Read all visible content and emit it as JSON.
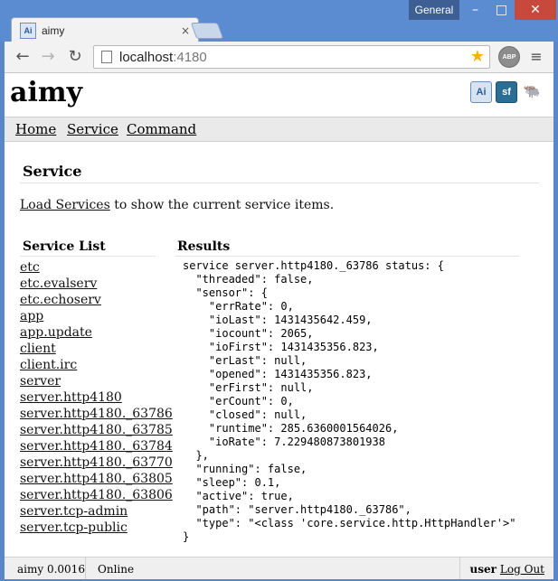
{
  "window": {
    "profile": "General",
    "min": "–",
    "max": "□",
    "close": "✕"
  },
  "tab": {
    "title": "aimy",
    "favicon_text": "Ai",
    "close": "×"
  },
  "toolbar": {
    "back": "←",
    "forward": "→",
    "reload": "↻",
    "url_host": "localhost",
    "url_port": ":4180",
    "star": "★",
    "abp": "ABP",
    "menu": "≡"
  },
  "page": {
    "site_title": "aimy",
    "header_icons": [
      "Ai",
      "sf",
      "🐃"
    ],
    "nav": [
      "Home",
      "Service",
      "Command"
    ],
    "section_title": "Service",
    "intro_link": "Load Services",
    "intro_text": " to show the current service items.",
    "list_title": "Service List",
    "services": [
      "etc",
      "etc.evalserv",
      "etc.echoserv",
      "app",
      "app.update",
      "client",
      "client.irc",
      "server",
      "server.http4180",
      "server.http4180._63786",
      "server.http4180._63785",
      "server.http4180._63784",
      "server.http4180._63770",
      "server.http4180._63805",
      "server.http4180._63806",
      "server.tcp-admin",
      "server.tcp-public"
    ],
    "results_title": "Results",
    "results_text": "service server.http4180._63786 status: {\n  \"threaded\": false,\n  \"sensor\": {\n    \"errRate\": 0,\n    \"ioLast\": 1431435642.459,\n    \"iocount\": 2065,\n    \"ioFirst\": 1431435356.823,\n    \"erLast\": null,\n    \"opened\": 1431435356.823,\n    \"erFirst\": null,\n    \"erCount\": 0,\n    \"closed\": null,\n    \"runtime\": 285.6360001564026,\n    \"ioRate\": 7.229480873801938\n  },\n  \"running\": false,\n  \"sleep\": 0.1,\n  \"active\": true,\n  \"path\": \"server.http4180._63786\",\n  \"type\": \"<class 'core.service.http.HttpHandler'>\"\n}"
  },
  "status": {
    "version": "aimy 0.0016",
    "state": "Online",
    "user": "user",
    "logout": "Log Out"
  }
}
